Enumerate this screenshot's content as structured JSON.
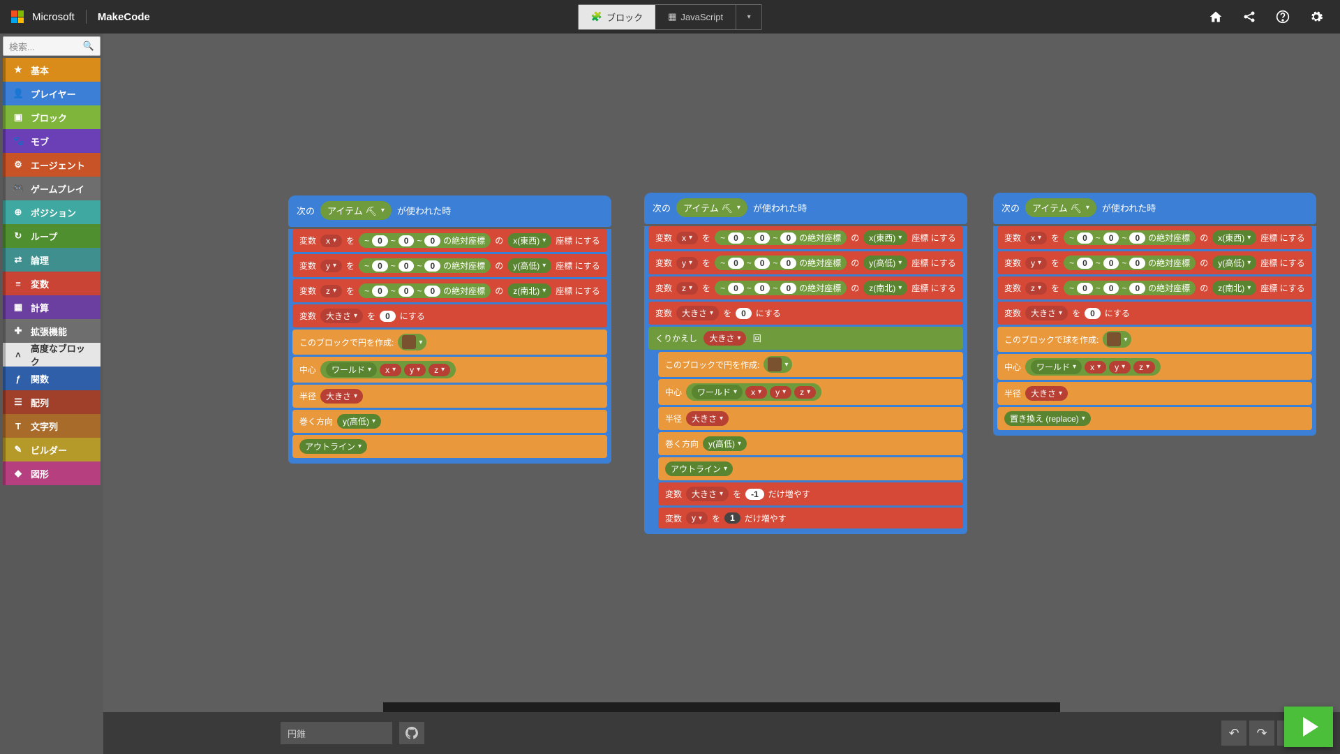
{
  "header": {
    "brand_ms": "Microsoft",
    "brand_mc": "MakeCode",
    "tab_blocks": "ブロック",
    "tab_js": "JavaScript"
  },
  "toolbox": {
    "search_placeholder": "検索...",
    "cats": [
      {
        "label": "基本",
        "color": "#d98c1a",
        "icon": "★"
      },
      {
        "label": "プレイヤー",
        "color": "#3b7fd6",
        "icon": "👤"
      },
      {
        "label": "ブロック",
        "color": "#7fb53b",
        "icon": "▣"
      },
      {
        "label": "モブ",
        "color": "#6b3fb5",
        "icon": "🐾"
      },
      {
        "label": "エージェント",
        "color": "#c75327",
        "icon": "⚙"
      },
      {
        "label": "ゲームプレイ",
        "color": "#6e6e6e",
        "icon": "🎮"
      },
      {
        "label": "ポジション",
        "color": "#3fa8a0",
        "icon": "⊕"
      },
      {
        "label": "ループ",
        "color": "#4f8f2f",
        "icon": "↻"
      },
      {
        "label": "論理",
        "color": "#3f8f8f",
        "icon": "⇄"
      },
      {
        "label": "変数",
        "color": "#c94434",
        "icon": "≡"
      },
      {
        "label": "計算",
        "color": "#6b3f9f",
        "icon": "▦"
      },
      {
        "label": "拡張機能",
        "color": "#6e6e6e",
        "icon": "✚"
      },
      {
        "label": "高度なブロック",
        "color": "#e6e6e6",
        "icon": "˄",
        "text": "#333"
      },
      {
        "label": "関数",
        "color": "#2f5fa8",
        "icon": "ƒ"
      },
      {
        "label": "配列",
        "color": "#a03f2a",
        "icon": "☰"
      },
      {
        "label": "文字列",
        "color": "#a86b2a",
        "icon": "T"
      },
      {
        "label": "ビルダー",
        "color": "#b59a2a",
        "icon": "✎"
      },
      {
        "label": "図形",
        "color": "#b53f7f",
        "icon": "◆"
      }
    ]
  },
  "labels": {
    "next": "次の",
    "item": "アイテム",
    "used": "が使われた時",
    "var": "変数",
    "wo": "を",
    "ni": "にする",
    "abs": "の絶対座標",
    "of": "の",
    "coord": "座標",
    "x": "x",
    "y": "y",
    "z": "z",
    "size": "大きさ",
    "xeast": "x(東西)",
    "yheight": "y(高低)",
    "zsouth": "z(南北)",
    "tilde": "~",
    "zero": "0",
    "neg1": "-1",
    "circle": "このブロックで円を作成:",
    "sphere": "このブロックで球を作成:",
    "center": "中心",
    "world": "ワールド",
    "radius": "半径",
    "orient": "巻く方向",
    "outline": "アウトライン",
    "repeat": "くりかえし",
    "times": "回",
    "increase": "だけ増やす",
    "replace": "置き換え (replace)"
  },
  "footer": {
    "project": "円錐"
  }
}
